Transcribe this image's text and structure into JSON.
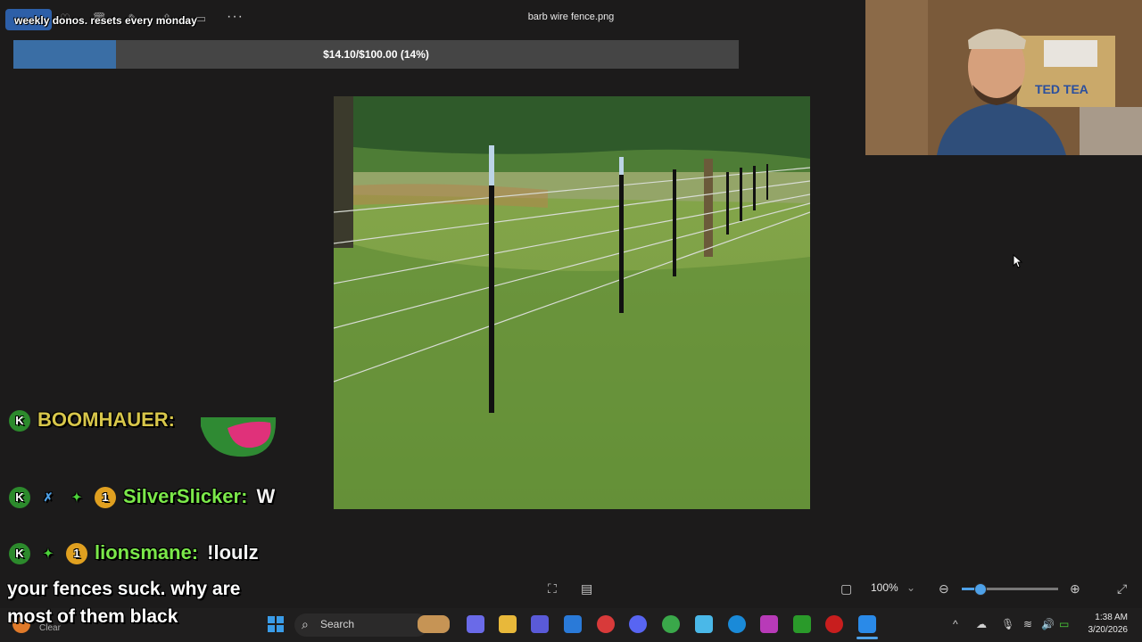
{
  "viewer": {
    "file_name": "barb wire fence.png",
    "zoom": "100%"
  },
  "donation_goal": {
    "label": "weekly donos. resets every monday",
    "text": "$14.10/$100.00 (14%)",
    "fraction": 0.141
  },
  "chat": {
    "partial_line": "BOOMHAUER:",
    "messages": [
      {
        "badge_k": "K",
        "badge_num": "1",
        "user": "SilverSlicker:",
        "text": "W"
      },
      {
        "badge_k": "K",
        "badge_num": "1",
        "user": "lionsmane:",
        "text": "!loulz"
      }
    ],
    "overlay_line1": "your fences suck. why are",
    "overlay_line2": "most of them black"
  },
  "taskbar": {
    "search_placeholder": "Search",
    "weather": "Clear",
    "time": "1:38 AM",
    "date": "3/20/2026"
  },
  "colors": {
    "accent": "#3a6ea5",
    "username": "#7be84a",
    "background": "#1c1b1b"
  },
  "icons": [
    "windows-start-icon",
    "search-icon",
    "zoom-in-icon",
    "zoom-out-icon",
    "fullscreen-icon",
    "fit-to-window-icon"
  ]
}
